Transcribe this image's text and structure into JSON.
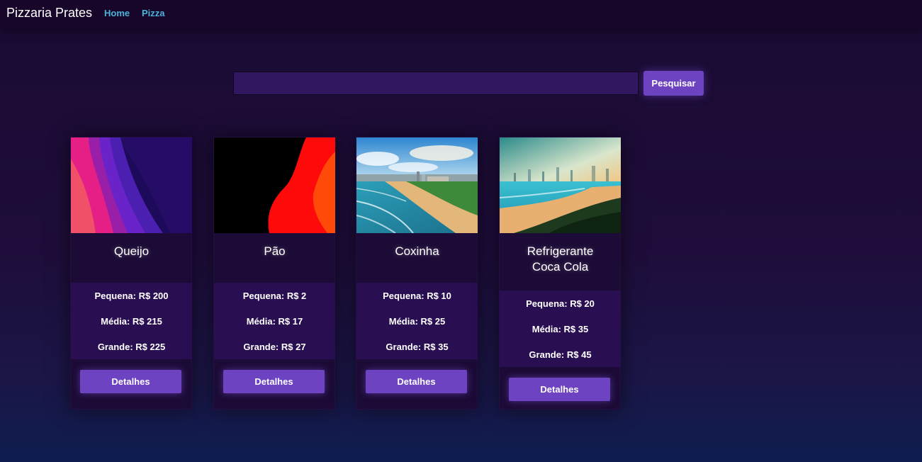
{
  "navbar": {
    "brand": "Pizzaria Prates",
    "links": [
      "Home",
      "Pizza"
    ]
  },
  "search": {
    "value": "",
    "button_label": "Pesquisar"
  },
  "products": [
    {
      "name": "Queijo",
      "prices": {
        "pequena": "Pequena: R$ 200",
        "media": "Média: R$ 215",
        "grande": "Grande: R$ 225"
      },
      "button_label": "Detalhes",
      "image": "abstract-waves-pink-purple"
    },
    {
      "name": "Pão",
      "prices": {
        "pequena": "Pequena: R$ 2",
        "media": "Média: R$ 17",
        "grande": "Grande: R$ 27"
      },
      "button_label": "Detalhes",
      "image": "abstract-red-black"
    },
    {
      "name": "Coxinha",
      "prices": {
        "pequena": "Pequena: R$ 10",
        "media": "Média: R$ 25",
        "grande": "Grande: R$ 35"
      },
      "button_label": "Detalhes",
      "image": "beach-city-photo"
    },
    {
      "name": "Refrigerante Coca Cola",
      "prices": {
        "pequena": "Pequena: R$ 20",
        "media": "Média: R$ 35",
        "grande": "Grande: R$ 45"
      },
      "button_label": "Detalhes",
      "image": "beach-city-painting"
    }
  ],
  "colors": {
    "accent": "#6d43c2",
    "nav_link": "#49b3d8",
    "navbar_bg": "#170629",
    "card_bg": "#1c0b36",
    "price_bg": "#290f52"
  }
}
